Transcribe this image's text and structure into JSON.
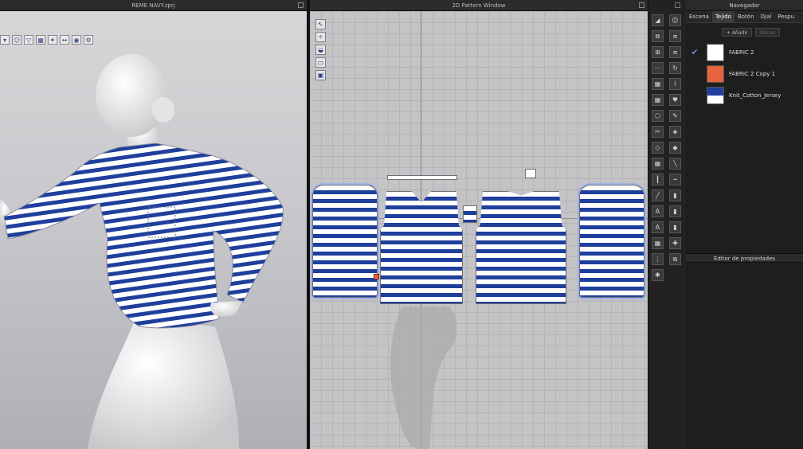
{
  "window3d": {
    "title": "REME NAVY.zprj"
  },
  "window2d": {
    "title": "2D Pattern Window"
  },
  "navigator": {
    "title": "Navegador",
    "tabs": [
      "Escena",
      "Tejido",
      "Botón",
      "Ojal",
      "Pespu"
    ],
    "active_tab": "Tejido",
    "actions": {
      "add": "Añadir",
      "delete": "Borrar"
    },
    "fabrics": [
      {
        "name": "FABRIC 2",
        "color": "#ffffff",
        "selected": true
      },
      {
        "name": "FABRIC 2 Copy 1",
        "color": "#e8623c",
        "selected": false
      },
      {
        "name": "Knit_Cotton_Jersey",
        "color": "#1f3f9c",
        "selected": false
      }
    ]
  },
  "properties": {
    "title": "Editor de propiedades"
  },
  "icons": {
    "toolbar3d": [
      "view-mode-icon",
      "avatar-icon",
      "garment-icon",
      "texture-icon",
      "pin-icon",
      "measure-icon",
      "camera-icon",
      "settings-icon"
    ],
    "toolbar2d": [
      "transform-icon",
      "edit-point-icon",
      "curve-icon",
      "segment-icon",
      "lock-icon"
    ]
  },
  "colors": {
    "accent": "#6c8ee8",
    "stripe_blue": "#1f3f9c",
    "panel_bg": "#1e1e1e"
  }
}
